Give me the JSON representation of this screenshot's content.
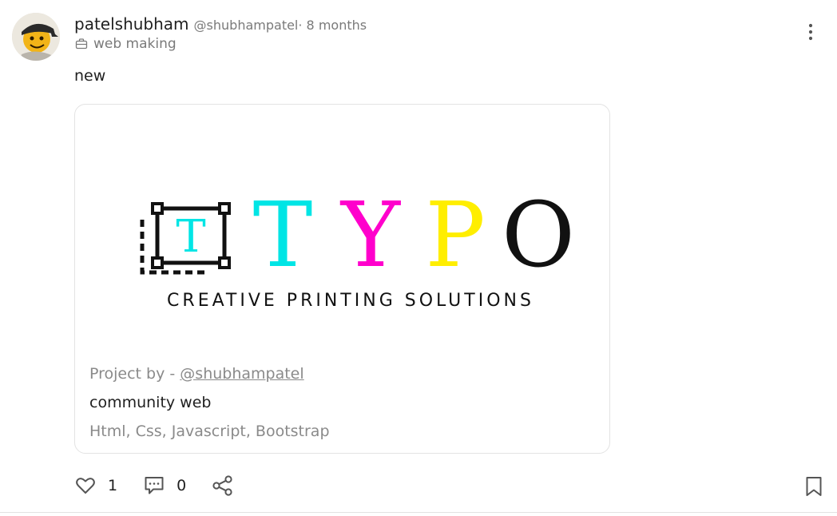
{
  "post": {
    "author": {
      "display_name": "patelshubham",
      "handle": "@shubhampatel",
      "time_ago": "· 8 months",
      "avatar_icon": "smiley-cap-avatar"
    },
    "category": {
      "icon": "briefcase-icon",
      "label": "web making"
    },
    "menu_icon": "more-vertical-icon",
    "text": "new",
    "project": {
      "logo": {
        "title_letters": [
          "T",
          "Y",
          "P",
          "O"
        ],
        "letter_colors": [
          "#00e5e5",
          "#ff00cc",
          "#ffee00",
          "#111111"
        ],
        "icon_letter": "T",
        "tagline": "CREATIVE PRINTING SOLUTIONS"
      },
      "by_prefix": "Project by - ",
      "by_handle": "@shubhampatel",
      "title": "community web",
      "tech": "Html, Css, Javascript, Bootstrap"
    },
    "actions": {
      "like": {
        "icon": "heart-icon",
        "count": "1"
      },
      "comment": {
        "icon": "comment-icon",
        "count": "0"
      },
      "share": {
        "icon": "share-icon"
      },
      "bookmark": {
        "icon": "bookmark-icon"
      }
    }
  }
}
